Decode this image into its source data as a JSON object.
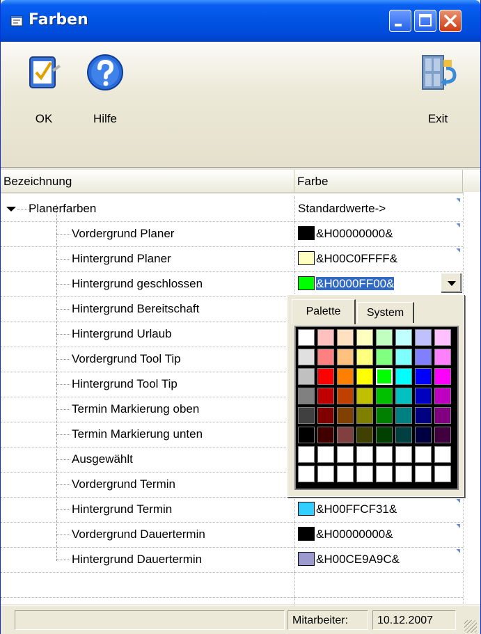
{
  "window": {
    "title": "Farben"
  },
  "toolbar": {
    "ok_label": "OK",
    "help_label": "Hilfe",
    "exit_label": "Exit"
  },
  "grid": {
    "columns": [
      "Bezeichnung",
      "Farbe"
    ],
    "group": {
      "label": "Planerfarben",
      "value": "Standardwerte->",
      "expanded": true
    },
    "rows": [
      {
        "label": "Vordergrund Planer",
        "value": "&H00000000&",
        "color": "#000000"
      },
      {
        "label": "Hintergrund Planer",
        "value": "&H00C0FFFF&",
        "color": "#ffffc0"
      },
      {
        "label": "Hintergrund geschlossen",
        "value": "&H0000FF00&",
        "color": "#00ff00",
        "selected": true
      },
      {
        "label": "Hintergrund Bereitschaft",
        "value": "",
        "color": ""
      },
      {
        "label": "Hintergrund Urlaub",
        "value": "",
        "color": ""
      },
      {
        "label": "Vordergrund Tool Tip",
        "value": "",
        "color": ""
      },
      {
        "label": "Hintergrund Tool Tip",
        "value": "",
        "color": ""
      },
      {
        "label": "Termin Markierung oben",
        "value": "",
        "color": ""
      },
      {
        "label": "Termin Markierung unten",
        "value": "",
        "color": ""
      },
      {
        "label": "Ausgewählt",
        "value": "",
        "color": ""
      },
      {
        "label": "Vordergrund Termin",
        "value": "",
        "color": ""
      },
      {
        "label": "Hintergrund Termin",
        "value": "&H00FFCF31&",
        "color": "#31cfff"
      },
      {
        "label": "Vordergrund Dauertermin",
        "value": "&H00000000&",
        "color": "#000000"
      },
      {
        "label": "Hintergrund Dauertermin",
        "value": "&H00CE9A9C&",
        "color": "#9c9ace"
      }
    ]
  },
  "palette": {
    "tabs": [
      "Palette",
      "System"
    ],
    "active_tab": "Palette",
    "selected_color": "#00ff00",
    "colors": [
      [
        "#ffffff",
        "#ffc0c0",
        "#ffe0c0",
        "#ffffc0",
        "#c0ffc0",
        "#c0ffff",
        "#c0c0ff",
        "#ffc0ff"
      ],
      [
        "#e0e0e0",
        "#ff8080",
        "#ffc080",
        "#ffff80",
        "#80ff80",
        "#80ffff",
        "#8080ff",
        "#ff80ff"
      ],
      [
        "#c0c0c0",
        "#ff0000",
        "#ff8000",
        "#ffff00",
        "#00ff00",
        "#00ffff",
        "#0000ff",
        "#ff00ff"
      ],
      [
        "#808080",
        "#c00000",
        "#c04000",
        "#c0c000",
        "#00c000",
        "#00c0c0",
        "#0000c0",
        "#c000c0"
      ],
      [
        "#404040",
        "#800000",
        "#804000",
        "#808000",
        "#008000",
        "#008080",
        "#000080",
        "#800080"
      ],
      [
        "#000000",
        "#400000",
        "#804040",
        "#404000",
        "#004000",
        "#004040",
        "#000040",
        "#400040"
      ],
      [
        "#ffffff",
        "#ffffff",
        "#ffffff",
        "#ffffff",
        "#ffffff",
        "#ffffff",
        "#ffffff",
        "#ffffff"
      ],
      [
        "#ffffff",
        "#ffffff",
        "#ffffff",
        "#ffffff",
        "#ffffff",
        "#ffffff",
        "#ffffff",
        "#ffffff"
      ]
    ]
  },
  "status": {
    "panel1": "",
    "panel2": "Mitarbeiter:",
    "panel3": "10.12.2007"
  }
}
